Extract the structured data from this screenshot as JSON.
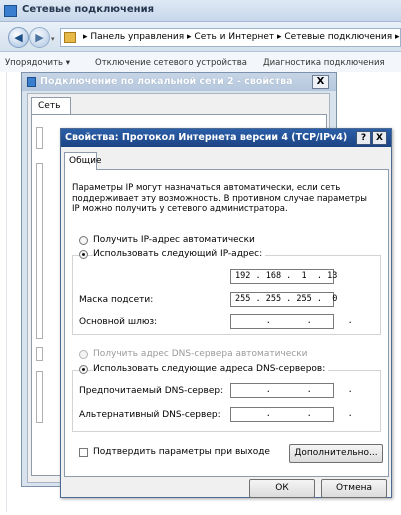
{
  "explorer": {
    "title": "Сетевые подключения",
    "back_glyph": "◀",
    "forward_glyph": "▶",
    "nav_dropdown_glyph": "▾",
    "address": "▸ Панель управления ▸ Сеть и Интернет ▸ Сетевые подключения ▸",
    "toolbar": {
      "organize": "Упорядочить ▾",
      "disable": "Отключение сетевого устройства",
      "diagnose": "Диагностика подключения"
    }
  },
  "back_dialog": {
    "title": "Подключение по локальной сети 2 - свойства",
    "close_glyph": "X",
    "tab": "Сеть"
  },
  "ipv4_dialog": {
    "title": "Свойства: Протокол Интернета версии 4 (TCP/IPv4)",
    "help_glyph": "?",
    "close_glyph": "X",
    "tab": "Общие",
    "description": "Параметры IP могут назначаться автоматически, если сеть поддерживает эту возможность. В противном случае параметры IP можно получить у сетевого администратора.",
    "ip_auto": {
      "label": "Получить IP-адрес автоматически",
      "selected": false
    },
    "ip_manual": {
      "label": "Использовать следующий IP-адрес:",
      "selected": true
    },
    "ip_address": {
      "label": "",
      "value": "192 . 168 .  1  . 13"
    },
    "subnet_mask": {
      "label": "Маска подсети:",
      "value": "255 . 255 . 255 .  0"
    },
    "gateway": {
      "label": "Основной шлюз:",
      "value": "      .       .       ."
    },
    "dns_auto": {
      "label": "Получить адрес DNS-сервера автоматически",
      "selected": false,
      "enabled": false
    },
    "dns_manual": {
      "label": "Использовать следующие адреса DNS-серверов:",
      "selected": true
    },
    "preferred_dns": {
      "label": "Предпочитаемый DNS-сервер:",
      "value": "      .       .       ."
    },
    "alternate_dns": {
      "label": "Альтернативный DNS-сервер:",
      "value": "      .       .       ."
    },
    "validate_on_exit": {
      "label": "Подтвердить параметры при выходе",
      "checked": false
    },
    "advanced_button": "Дополнительно...",
    "ok_button": "ОК",
    "cancel_button": "Отмена"
  }
}
